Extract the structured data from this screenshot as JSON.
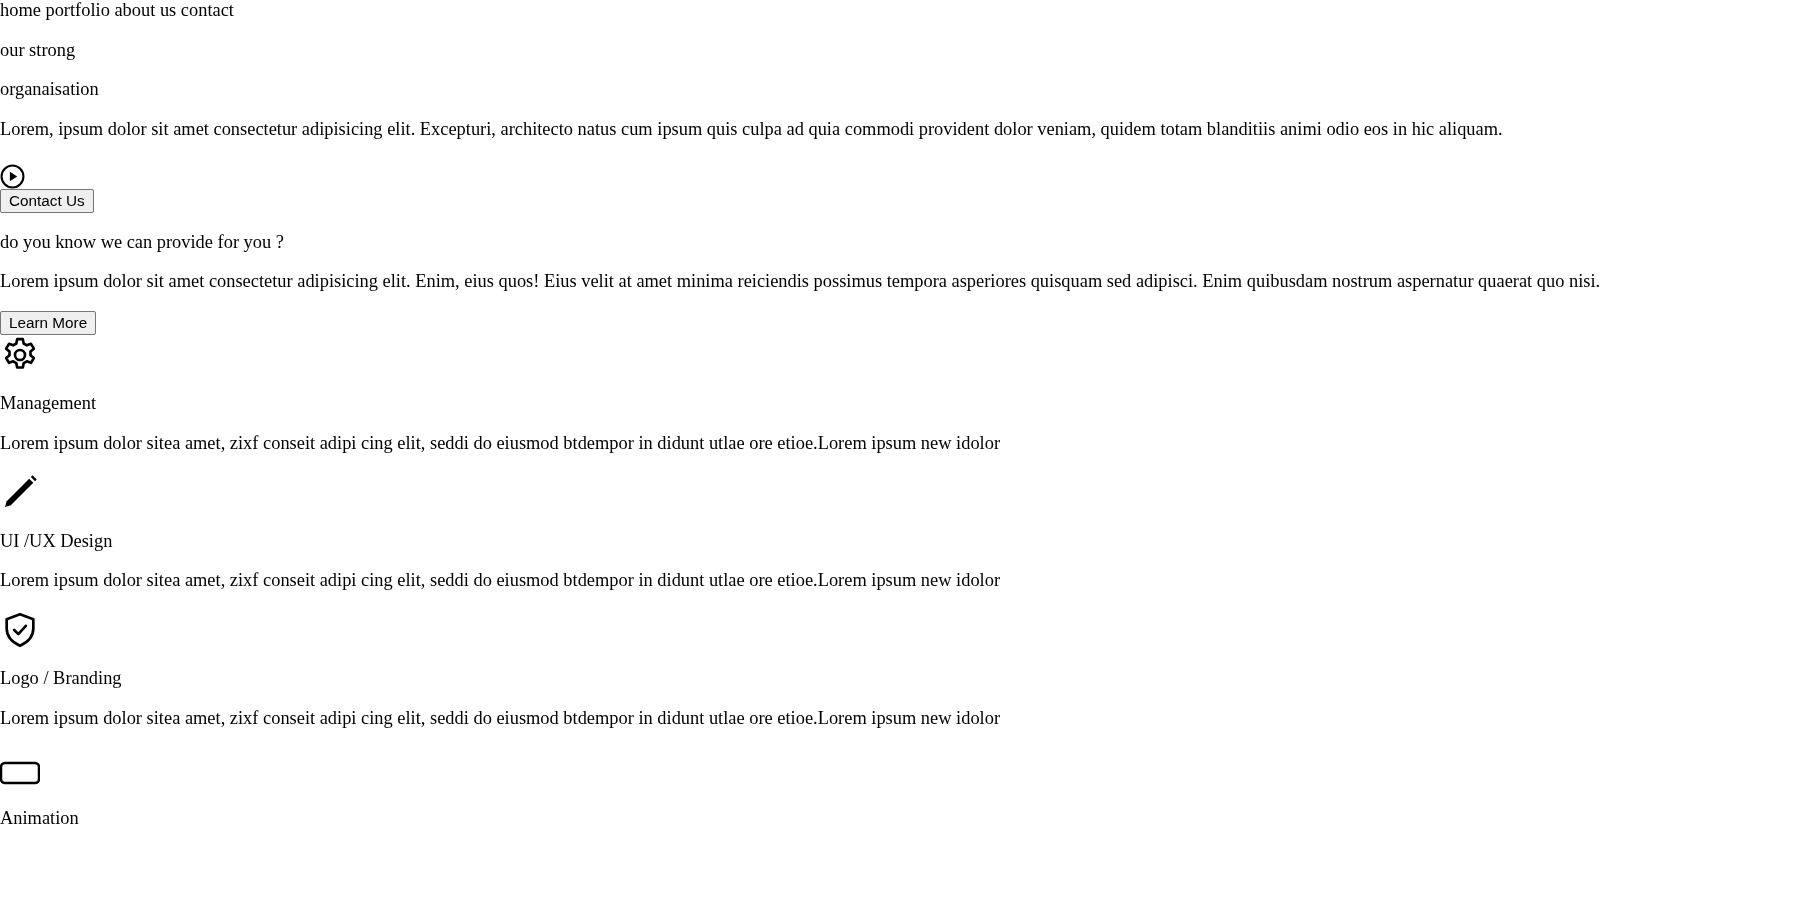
{
  "nav": {
    "links": [
      "home",
      "portfolio",
      "about us",
      "contact"
    ]
  },
  "hero": {
    "title_lines": [
      "our strong",
      "organaisation"
    ],
    "text": "Lorem, ipsum dolor sit amet consectetur adipisicing elit. Excepturi, architecto natus cum ipsum quis culpa ad quia commodi provident dolor veniam, quidem totam blanditiis animi odio eos in hic aliquam.",
    "button": "Contact Us"
  },
  "about": {
    "heading": "do you know we can provide for you ?",
    "text": "Lorem ipsum dolor sit amet consectetur adipisicing elit. Enim, eius quos! Eius velit at amet minima reiciendis possimus tempora asperiores quisquam sed adipisci. Enim quibusdam nostrum aspernatur quaerat quo nisi.",
    "button": "Learn More"
  },
  "services": [
    {
      "title": "Management",
      "text": "Lorem ipsum dolor sitea amet, zixf conseit adipi cing elit, seddi do eiusmod btdempor in didunt utlae ore etioe.Lorem ipsum new idolor"
    },
    {
      "title": "UI /UX Design",
      "text": "Lorem ipsum dolor sitea amet, zixf conseit adipi cing elit, seddi do eiusmod btdempor in didunt utlae ore etioe.Lorem ipsum new idolor"
    },
    {
      "title": "Logo / Branding",
      "text": "Lorem ipsum dolor sitea amet, zixf conseit adipi cing elit, seddi do eiusmod btdempor in didunt utlae ore etioe.Lorem ipsum new idolor"
    },
    {
      "title": "Animation"
    }
  ]
}
